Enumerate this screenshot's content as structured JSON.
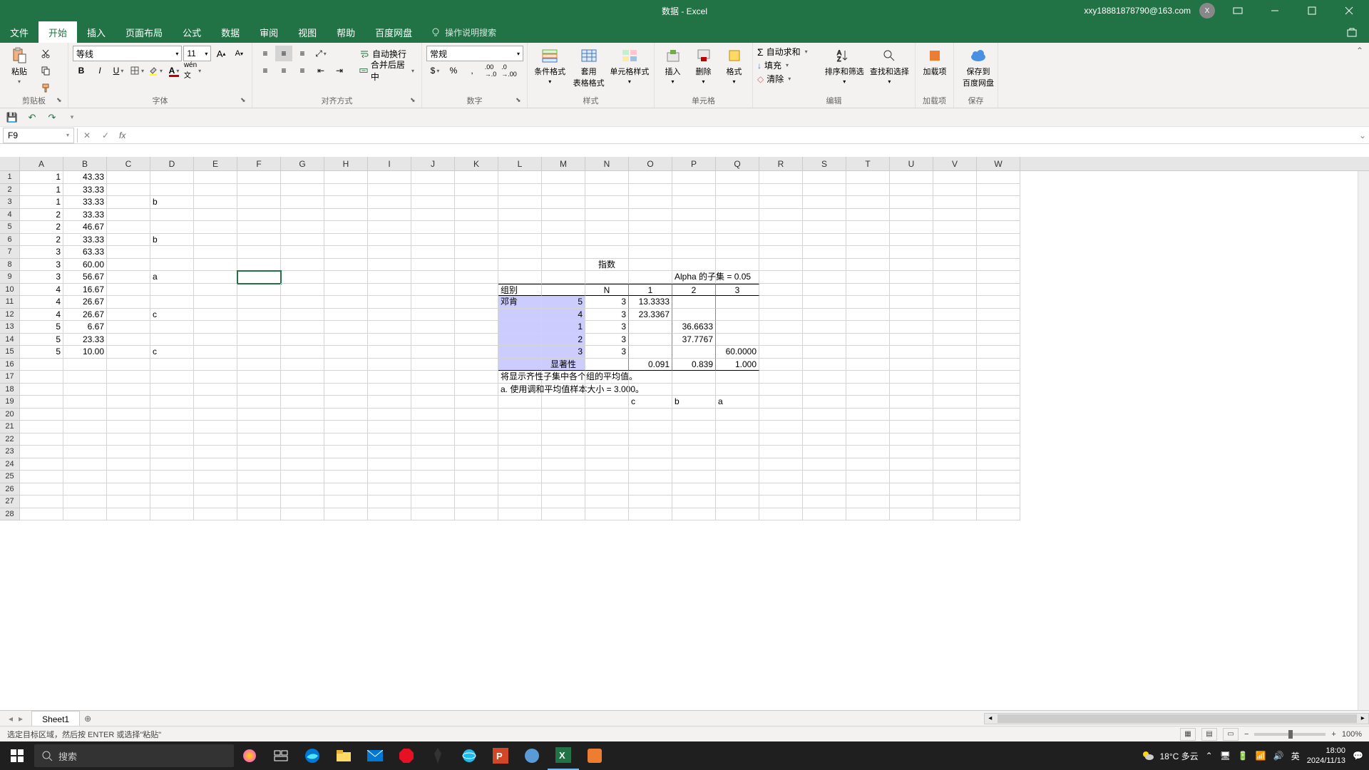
{
  "title": "数据 - Excel",
  "user": "xxy18881878790@163.com",
  "avatar_letter": "X",
  "tabs": {
    "file": "文件",
    "home": "开始",
    "insert": "插入",
    "pagelayout": "页面布局",
    "formulas": "公式",
    "data": "数据",
    "review": "审阅",
    "view": "视图",
    "help": "帮助",
    "baidu": "百度网盘"
  },
  "tellme": "操作说明搜索",
  "ribbon": {
    "clipboard": {
      "paste": "粘贴",
      "label": "剪贴板"
    },
    "font": {
      "name": "等线",
      "size": "11",
      "label": "字体"
    },
    "align": {
      "wrap": "自动换行",
      "merge": "合并后居中",
      "label": "对齐方式"
    },
    "number": {
      "format": "常规",
      "label": "数字"
    },
    "styles": {
      "cond": "条件格式",
      "table": "套用\n表格格式",
      "cellstyle": "单元格样式",
      "label": "样式"
    },
    "cells": {
      "insert": "插入",
      "delete": "删除",
      "format": "格式",
      "label": "单元格"
    },
    "editing": {
      "autosum": "自动求和",
      "fill": "填充",
      "clear": "清除",
      "sortfilter": "排序和筛选",
      "findselect": "查找和选择",
      "label": "编辑"
    },
    "addins": {
      "addin": "加载项",
      "label": "加载项"
    },
    "save": {
      "baidu": "保存到\n百度网盘",
      "label": "保存"
    }
  },
  "namebox": "F9",
  "columns": [
    "A",
    "B",
    "C",
    "D",
    "E",
    "F",
    "G",
    "H",
    "I",
    "J",
    "K",
    "L",
    "M",
    "N",
    "O",
    "P",
    "Q",
    "R",
    "S",
    "T",
    "U",
    "V",
    "W"
  ],
  "rowcount": 28,
  "data_rows": [
    {
      "a": "1",
      "b": "43.33",
      "c": ""
    },
    {
      "a": "1",
      "b": "33.33",
      "c": ""
    },
    {
      "a": "1",
      "b": "33.33",
      "c": "b"
    },
    {
      "a": "2",
      "b": "33.33",
      "c": ""
    },
    {
      "a": "2",
      "b": "46.67",
      "c": ""
    },
    {
      "a": "2",
      "b": "33.33",
      "c": "b"
    },
    {
      "a": "3",
      "b": "63.33",
      "c": ""
    },
    {
      "a": "3",
      "b": "60.00",
      "c": ""
    },
    {
      "a": "3",
      "b": "56.67",
      "c": "a"
    },
    {
      "a": "4",
      "b": "16.67",
      "c": ""
    },
    {
      "a": "4",
      "b": "26.67",
      "c": ""
    },
    {
      "a": "4",
      "b": "26.67",
      "c": "c"
    },
    {
      "a": "5",
      "b": "6.67",
      "c": ""
    },
    {
      "a": "5",
      "b": "23.33",
      "c": ""
    },
    {
      "a": "5",
      "b": "10.00",
      "c": "c"
    }
  ],
  "stats": {
    "title": "指数",
    "subtitle": "Alpha 的子集 = 0.05",
    "group_label": "组别",
    "n_label": "N",
    "subset_cols": [
      "1",
      "2",
      "3"
    ],
    "dunken": "邓肯",
    "rows": [
      {
        "id": "5",
        "n": "3",
        "v1": "13.3333",
        "v2": "",
        "v3": ""
      },
      {
        "id": "4",
        "n": "3",
        "v1": "23.3367",
        "v2": "",
        "v3": ""
      },
      {
        "id": "1",
        "n": "3",
        "v1": "",
        "v2": "36.6633",
        "v3": ""
      },
      {
        "id": "2",
        "n": "3",
        "v1": "",
        "v2": "37.7767",
        "v3": ""
      },
      {
        "id": "3",
        "n": "3",
        "v1": "",
        "v2": "",
        "v3": "60.0000"
      }
    ],
    "sig_label": "显著性",
    "sig": [
      "0.091",
      "0.839",
      "1.000"
    ],
    "note1": "将显示齐性子集中各个组的平均值。",
    "note2": "a. 使用调和平均值样本大小 = 3.000。",
    "letters": [
      "c",
      "b",
      "a"
    ]
  },
  "sheet": "Sheet1",
  "status": "选定目标区域，然后按 ENTER 或选择\"粘贴\"",
  "zoom": "100%",
  "taskbar": {
    "search_placeholder": "搜索",
    "weather": "18°C 多云",
    "ime": "英",
    "time": "18:00",
    "date": "2024/11/13"
  }
}
